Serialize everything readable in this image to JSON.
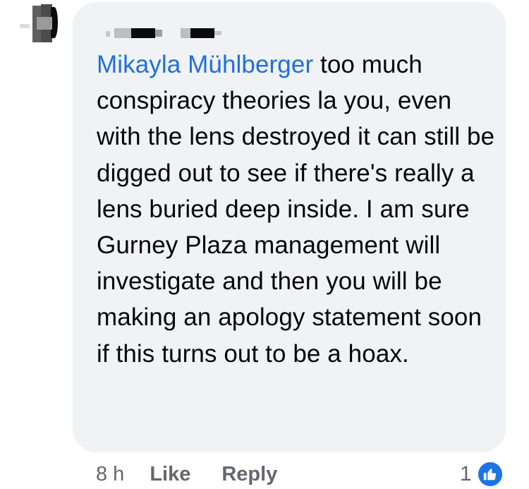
{
  "comment": {
    "mention": "Mikayla Mühlberger",
    "text": " too much conspiracy theories la you, even with the lens destroyed it can still be digged out to see if there's really a lens buried deep inside. I am sure Gurney Plaza management will investigate and then you will be making an apology statement soon if this turns out to be a hoax."
  },
  "footer": {
    "time": "8 h",
    "like_label": "Like",
    "reply_label": "Reply",
    "reaction_count": "1",
    "reaction_icon": "thumbs-up-icon"
  },
  "colors": {
    "bubble": "#f0f2f5",
    "mention": "#216fdb",
    "meta": "#65676b",
    "like_badge": "#1b74e4"
  }
}
